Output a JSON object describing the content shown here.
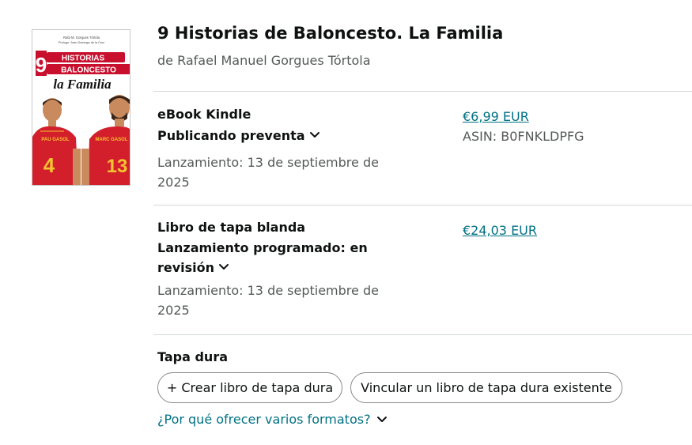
{
  "book": {
    "title": "9 Historias de Baloncesto. La Familia",
    "author": "de Rafael Manuel Gorgues Tórtola",
    "cover": {
      "top_line_1": "Rafa M. Gorgues Tórtola",
      "top_line_2": "Prólogo: Juan Domingo de la Cruz",
      "number": "9",
      "word_1": "HISTORIAS",
      "word_de": "de",
      "word_2": "BALONCESTO",
      "subtitle": "la Familia",
      "player_left_name": "PAU GASOL",
      "player_left_number": "4",
      "player_right_name": "MARC GASOL",
      "player_right_number": "13",
      "colors": {
        "red": "#c8102e",
        "jersey": "#d31f2b",
        "yellow": "#f4c430",
        "skin": "#c98a5e",
        "hair": "#3a2418"
      }
    }
  },
  "formats": {
    "ebook": {
      "name": "eBook Kindle",
      "status": "Publicando preventa",
      "release": "Lanzamiento: 13 de septiembre de 2025",
      "price": "€6,99 EUR",
      "asin": "ASIN: B0FNKLDPFG"
    },
    "paperback": {
      "name": "Libro de tapa blanda",
      "status_line_1": "Lanzamiento programado: en",
      "status_line_2": "revisión",
      "release": "Lanzamiento: 13 de septiembre de 2025",
      "price": "€24,03 EUR"
    },
    "hardcover": {
      "name": "Tapa dura",
      "create_button": "+ Crear libro de tapa dura",
      "link_button": "Vincular un libro de tapa dura existente"
    }
  },
  "why_link": "¿Por qué ofrecer varios formatos?",
  "icons": {
    "expand": "chevron-down-icon"
  },
  "colors": {
    "link": "#007185",
    "text": "#0f1111",
    "secondary": "#565959",
    "divider": "#d5d9d9"
  }
}
